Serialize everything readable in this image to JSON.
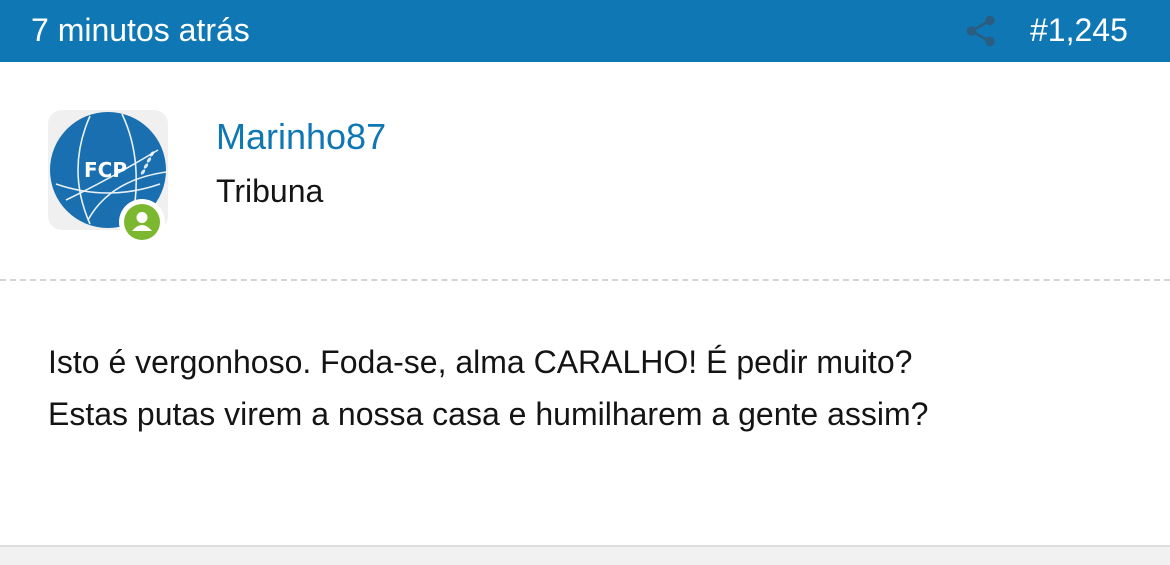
{
  "header": {
    "time_ago": "7 minutos atrás",
    "post_number": "#1,245",
    "share_icon": "share-icon",
    "background_color": "#0f78b4"
  },
  "author": {
    "avatar_text": "FCP",
    "username": "Marinho87",
    "user_title": "Tribuna",
    "online_status_icon": "user-online-icon",
    "status_color": "#7cb82f",
    "username_color": "#0f78b4"
  },
  "post": {
    "lines": [
      "Isto é vergonhoso. Foda-se, alma CARALHO! É pedir muito?",
      "Estas putas virem a nossa casa e humilharem a gente assim?"
    ]
  }
}
